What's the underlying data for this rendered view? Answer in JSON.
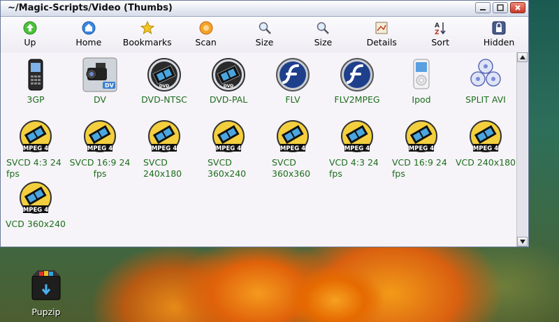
{
  "window": {
    "title": "~/Magic-Scripts/Video (Thumbs)"
  },
  "toolbar": {
    "items": [
      {
        "label": "Up",
        "icon": "up-arrow-icon"
      },
      {
        "label": "Home",
        "icon": "home-icon"
      },
      {
        "label": "Bookmarks",
        "icon": "star-icon"
      },
      {
        "label": "Scan",
        "icon": "scan-icon"
      },
      {
        "label": "Size",
        "icon": "zoom-in-icon"
      },
      {
        "label": "Size",
        "icon": "zoom-out-icon"
      },
      {
        "label": "Details",
        "icon": "details-icon"
      },
      {
        "label": "Sort",
        "icon": "sort-icon"
      },
      {
        "label": "Hidden",
        "icon": "hidden-lock-icon"
      }
    ]
  },
  "files": [
    {
      "label": "3GP",
      "icon": "phone-icon"
    },
    {
      "label": "DV",
      "icon": "camcorder-icon"
    },
    {
      "label": "DVD-NTSC",
      "icon": "dvd-film-icon"
    },
    {
      "label": "DVD-PAL",
      "icon": "dvd-film-icon"
    },
    {
      "label": "FLV",
      "icon": "flash-icon"
    },
    {
      "label": "FLV2MPEG",
      "icon": "flash-icon"
    },
    {
      "label": "Ipod",
      "icon": "ipod-icon"
    },
    {
      "label": "SPLIT AVI",
      "icon": "discs-icon"
    },
    {
      "label": "SVCD 4:3 24 fps",
      "icon": "mpeg4-icon"
    },
    {
      "label": "SVCD 16:9 24 fps",
      "icon": "mpeg4-icon"
    },
    {
      "label": "SVCD 240x180",
      "icon": "mpeg4-icon"
    },
    {
      "label": "SVCD 360x240",
      "icon": "mpeg4-icon"
    },
    {
      "label": "SVCD 360x360",
      "icon": "mpeg4-icon"
    },
    {
      "label": "VCD 4:3 24 fps",
      "icon": "mpeg4-icon"
    },
    {
      "label": "VCD 16:9 24 fps",
      "icon": "mpeg4-icon"
    },
    {
      "label": "VCD 240x180",
      "icon": "mpeg4-icon"
    },
    {
      "label": "VCD 360x240",
      "icon": "mpeg4-icon"
    }
  ],
  "mpeg_badge": "MPEG 4",
  "desktop": {
    "icon_label": "Pupzip"
  }
}
